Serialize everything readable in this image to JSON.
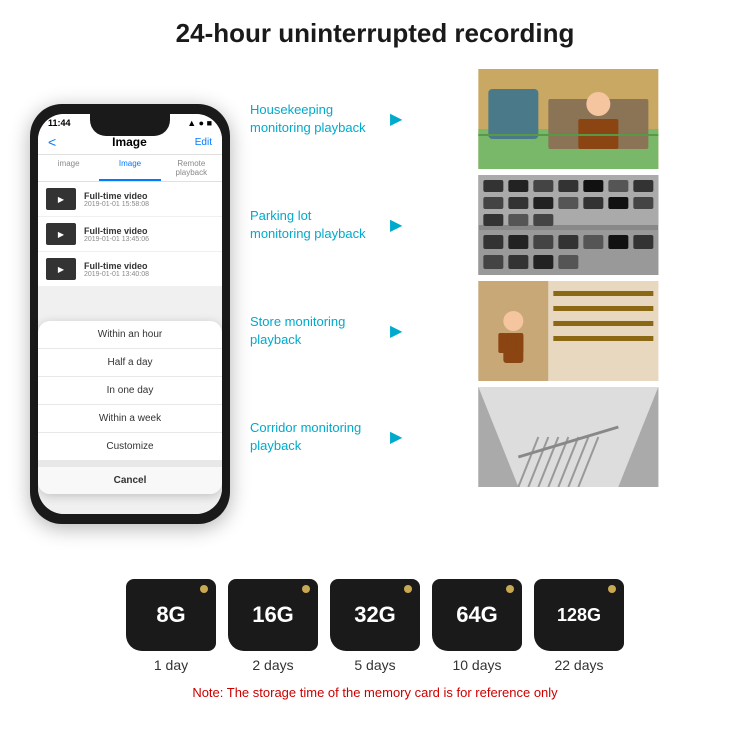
{
  "header": {
    "title": "24-hour uninterrupted recording"
  },
  "phone": {
    "status_time": "11:44",
    "nav_title": "Image",
    "nav_edit": "Edit",
    "nav_back": "<",
    "tabs": [
      {
        "label": "image",
        "active": false
      },
      {
        "label": "Image",
        "active": true
      },
      {
        "label": "Remote playback",
        "active": false
      }
    ],
    "list_items": [
      {
        "title": "Full-time video",
        "date": "2019-01-01 15:58:08"
      },
      {
        "title": "Full-time video",
        "date": "2019-01-01 13:45:06"
      },
      {
        "title": "Full-time video",
        "date": "2019-01-01 13:40:08"
      }
    ],
    "dropdown_items": [
      "Within an hour",
      "Half a day",
      "In one day",
      "Within a week",
      "Customize"
    ],
    "dropdown_cancel": "Cancel"
  },
  "monitoring": [
    {
      "label": "Housekeeping\nmonitoring playback",
      "type": "housekeeping"
    },
    {
      "label": "Parking lot\nmonitoring playback",
      "type": "parking"
    },
    {
      "label": "Store monitoring\nplayback",
      "type": "store"
    },
    {
      "label": "Corridor monitoring\nplayback",
      "type": "corridor"
    }
  ],
  "storage_cards": [
    {
      "size": "8G",
      "days": "1 day"
    },
    {
      "size": "16G",
      "days": "2 days"
    },
    {
      "size": "32G",
      "days": "5 days"
    },
    {
      "size": "64G",
      "days": "10 days"
    },
    {
      "size": "128G",
      "days": "22 days"
    }
  ],
  "storage_note": "Note: The storage time of the memory card is for reference only"
}
